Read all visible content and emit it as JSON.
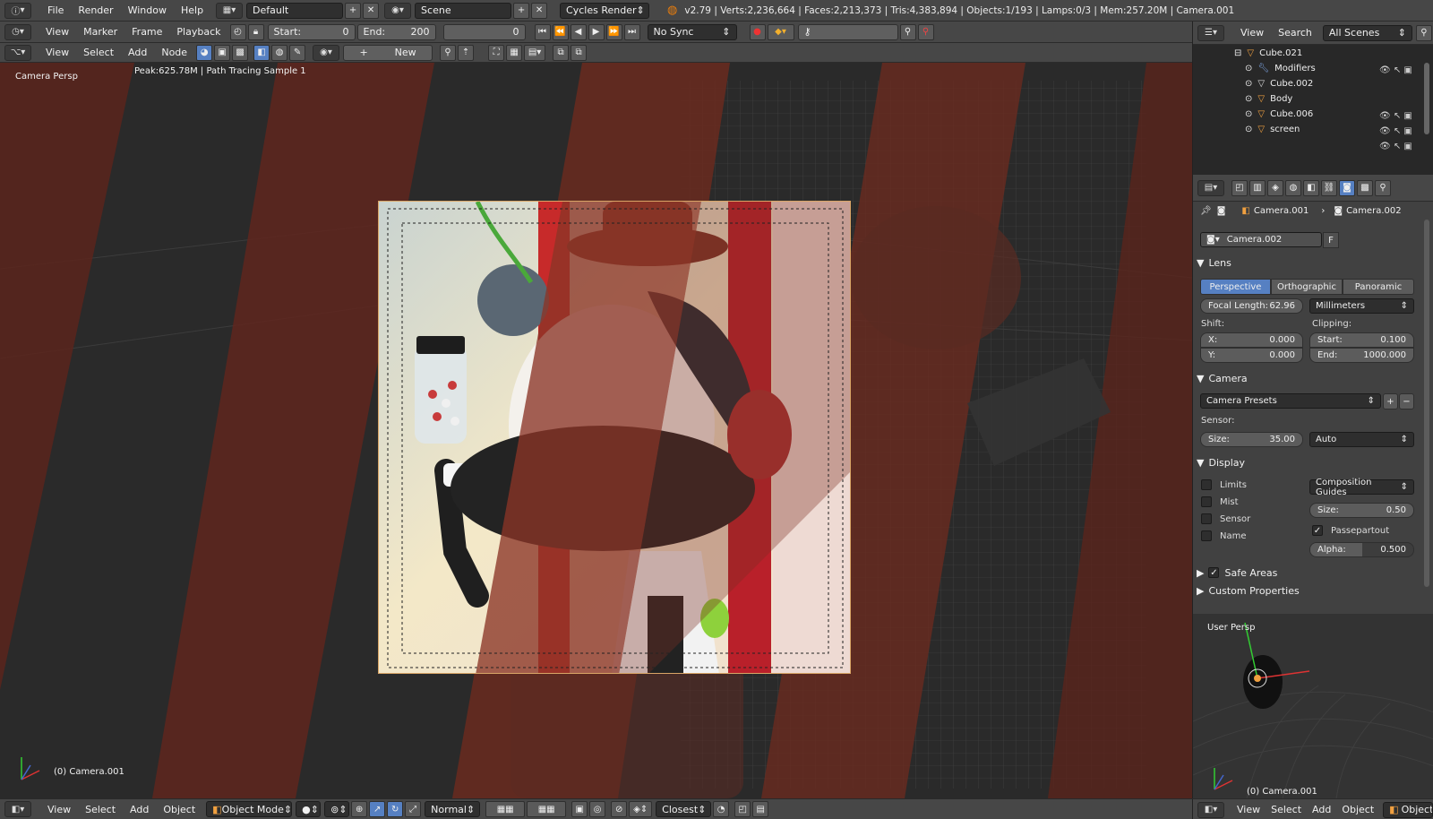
{
  "info_bar": {
    "menus": [
      "File",
      "Render",
      "Window",
      "Help"
    ],
    "screen_layout": "Default",
    "scene": "Scene",
    "engine": "Cycles Render",
    "stats": "v2.79 | Verts:2,236,664 | Faces:2,213,373 | Tris:4,383,894 | Objects:1/193 | Lamps:0/3 | Mem:257.20M | Camera.001"
  },
  "timeline_bar": {
    "menus": [
      "View",
      "Marker",
      "Frame",
      "Playback"
    ],
    "start_label": "Start:",
    "start_value": "0",
    "end_label": "End:",
    "end_value": "200",
    "current_frame": "0",
    "sync": "No Sync"
  },
  "node_bar": {
    "menus": [
      "View",
      "Select",
      "Add",
      "Node"
    ],
    "new_button": "New"
  },
  "viewport": {
    "view_name": "Camera Persp",
    "render_status": "Peak:625.78M | Path Tracing Sample 1",
    "object_label": "(0) Camera.001"
  },
  "outliner": {
    "menus": [
      "View",
      "Search"
    ],
    "filter": "All Scenes",
    "rows": [
      {
        "name": "Cube.021"
      },
      {
        "name": "Modifiers"
      },
      {
        "name": "Cube.002"
      },
      {
        "name": "Body"
      },
      {
        "name": "Cube.006"
      },
      {
        "name": "screen"
      }
    ]
  },
  "properties": {
    "breadcrumb_object": "Camera.001",
    "breadcrumb_data": "Camera.002",
    "datablock_name": "Camera.002",
    "fake_user": "F",
    "lens": {
      "title": "Lens",
      "tabs": [
        "Perspective",
        "Orthographic",
        "Panoramic"
      ],
      "focal_label": "Focal Length:",
      "focal_value": "62.96",
      "unit": "Millimeters",
      "shift_label": "Shift:",
      "clipping_label": "Clipping:",
      "x_label": "X:",
      "x_value": "0.000",
      "y_label": "Y:",
      "y_value": "0.000",
      "start_label": "Start:",
      "start_value": "0.100",
      "end_label": "End:",
      "end_value": "1000.000"
    },
    "camera": {
      "title": "Camera",
      "presets": "Camera Presets",
      "sensor_label": "Sensor:",
      "size_label": "Size:",
      "size_value": "35.00",
      "fit": "Auto"
    },
    "display": {
      "title": "Display",
      "checks": [
        "Limits",
        "Mist",
        "Sensor",
        "Name"
      ],
      "guides": "Composition Guides",
      "size_label": "Size:",
      "size_value": "0.50",
      "passepartout": "Passepartout",
      "alpha_label": "Alpha:",
      "alpha_value": "0.500",
      "alpha_fraction": 0.5
    },
    "safe_areas": "Safe Areas",
    "custom_properties": "Custom Properties"
  },
  "mini_view": {
    "view_name": "User Persp",
    "object_label": "(0) Camera.001"
  },
  "bottom_bar": {
    "menus": [
      "View",
      "Select",
      "Add",
      "Object"
    ],
    "mode": "Object Mode",
    "orientation": "Normal",
    "snap": "Closest",
    "right_menus": [
      "View",
      "Select",
      "Add",
      "Object"
    ],
    "right_mode": "Object Mo"
  }
}
